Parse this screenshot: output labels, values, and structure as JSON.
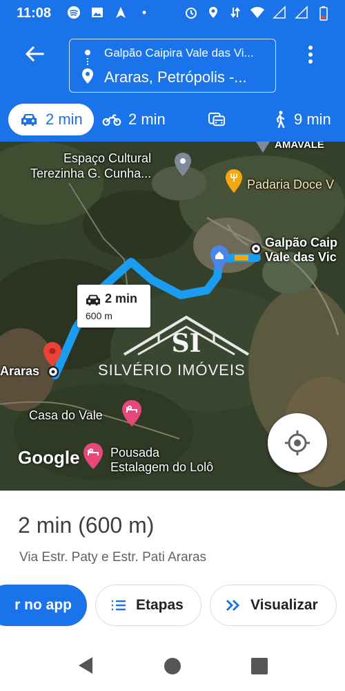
{
  "status_bar": {
    "time": "11:08",
    "icons_left": [
      "spotify-icon",
      "image-icon",
      "navigation-icon",
      "dot-icon"
    ],
    "icons_right": [
      "alarm-icon",
      "location-icon",
      "data-icon",
      "wifi-icon",
      "signal-icon",
      "signal-icon",
      "battery-icon"
    ]
  },
  "header": {
    "origin": "Galpão Caipira Vale das Vi...",
    "destination": "Araras, Petrópolis -..."
  },
  "modes": [
    {
      "icon": "car-icon",
      "label": "2 min",
      "active": true
    },
    {
      "icon": "motorcycle-icon",
      "label": "2 min",
      "active": false
    },
    {
      "icon": "transit-icon",
      "label": "",
      "active": false
    },
    {
      "icon": "walk-icon",
      "label": "9 min",
      "active": false
    }
  ],
  "map": {
    "labels": {
      "espaco_line1": "Espaço Cultural",
      "espaco_line2": "Terezinha G. Cunha...",
      "padaria": "Padaria Doce V",
      "amavale": "AMAVALE",
      "galpao_line1": "Galpão Caip",
      "galpao_line2": "Vale das Vic",
      "araras": "Araras",
      "casa_do_vale": "Casa do Vale",
      "pousada_line1": "Pousada",
      "pousada_line2": "Estalagem do Lolô"
    },
    "route_badge": {
      "time": "2 min",
      "distance": "600 m"
    },
    "watermark_text": "SILVÉRIO IMÓVEIS",
    "watermark_monogram": "SI",
    "google": "Google"
  },
  "sheet": {
    "summary": "2 min (600 m)",
    "via": "Via Estr. Paty e Estr. Pati Araras",
    "buttons": {
      "open_app": "r no app",
      "steps": "Etapas",
      "preview": "Visualizar"
    }
  },
  "colors": {
    "accent": "#1a73e8",
    "route": "#1a9cf0",
    "pin_red": "#ea4335",
    "poi_orange": "#f4a70f",
    "poi_pink": "#e8477a"
  }
}
